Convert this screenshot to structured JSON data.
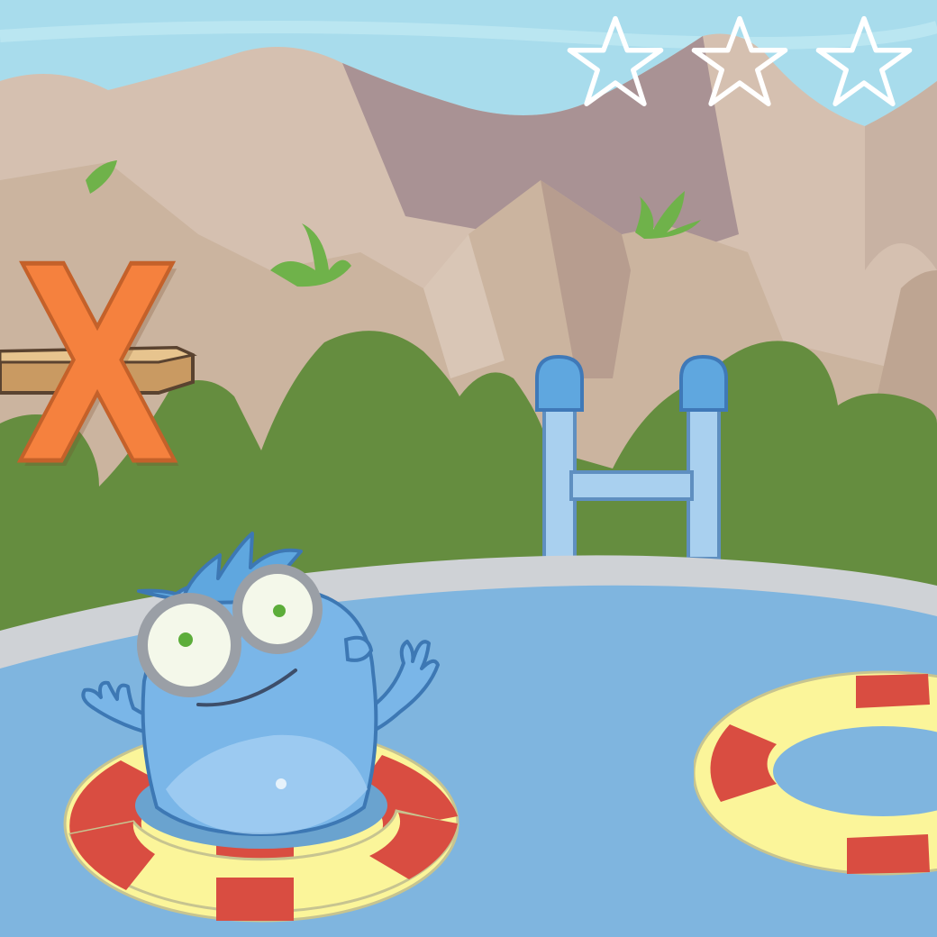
{
  "game": {
    "target_letter": "X",
    "stars_total": 3,
    "stars_earned": 0
  },
  "colors": {
    "sky": "#a8dcec",
    "mountain_light": "#d5c0b0",
    "mountain_dark": "#a99294",
    "bush": "#658d3f",
    "pool_water": "#7fb5df",
    "pool_rim": "#cfd2d6",
    "ladder": "#a9d0ef",
    "letter": "#f5813e",
    "ring_red": "#d94d41",
    "ring_yellow": "#fbf59a",
    "monster": "#7ab6e8"
  },
  "icons": {
    "star": "star-outline-icon",
    "ring": "swim-ring-icon",
    "character": "blue-monster-character"
  }
}
